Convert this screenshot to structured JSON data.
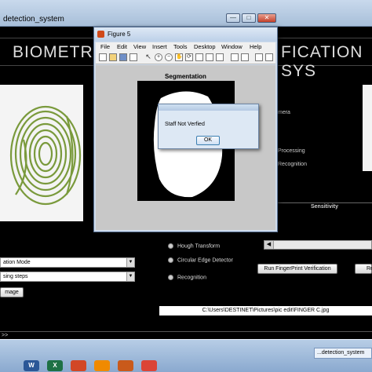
{
  "main_window": {
    "title": "detection_system",
    "controls": [
      "—",
      "□",
      "✕"
    ]
  },
  "banner": {
    "left_text": "BIOMETRIC",
    "right_text": "FICATION SYS"
  },
  "options_right": {
    "item1": "mera",
    "item2": "Processing",
    "item3": "Recognition"
  },
  "sensitivity_label": "Sensitivity",
  "radios": [
    "Hough Transform",
    "Circular Edge Detector",
    "Recognition"
  ],
  "dropdowns": [
    "ation Mode",
    "sing steps"
  ],
  "image_button": "mage",
  "verify_button": "Run FingerPrint Verification",
  "right_button": "Re",
  "path": "C:\\Users\\DESTINET\\Pictures\\pic edit\\FINGER C.jpg",
  "cmd_prompt": ">>",
  "taskbar": {
    "item": "...detection_system",
    "apps": [
      {
        "name": "word-app-icon",
        "color": "#2b5797",
        "label": "W"
      },
      {
        "name": "excel-app-icon",
        "color": "#1e7145",
        "label": "X"
      },
      {
        "name": "powerpoint-app-icon",
        "color": "#d24726",
        "label": ""
      },
      {
        "name": "vlc-app-icon",
        "color": "#f08a00",
        "label": ""
      },
      {
        "name": "matlab-app-icon",
        "color": "#c95a1b",
        "label": ""
      },
      {
        "name": "chrome-app-icon",
        "color": "#db4437",
        "label": ""
      }
    ]
  },
  "figure": {
    "title": "Figure 5",
    "menu": [
      "File",
      "Edit",
      "View",
      "Insert",
      "Tools",
      "Desktop",
      "Window",
      "Help"
    ],
    "plot_title": "Segmentation"
  },
  "dialog": {
    "message": "Staff Not Verfied",
    "ok": "OK"
  },
  "colors": {
    "fingerprint": "#7a9a3c",
    "background": "#000000"
  }
}
